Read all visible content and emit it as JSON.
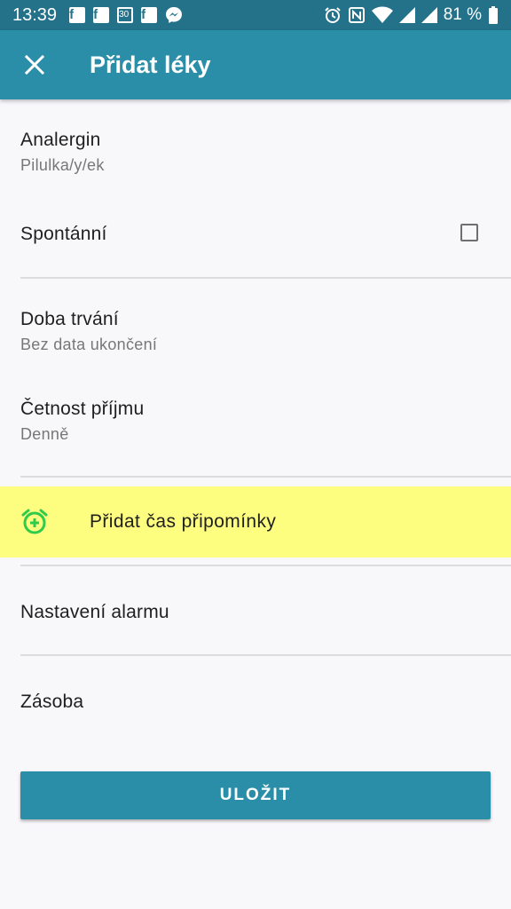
{
  "status_bar": {
    "time": "13:39",
    "notification_icons": [
      "facebook-icon",
      "facebook-icon",
      "calendar-icon",
      "facebook-icon",
      "messenger-icon"
    ],
    "calendar_date": "30",
    "system_icons": [
      "alarm-clock-icon",
      "nfc-icon",
      "wifi-icon",
      "signal-icon",
      "signal-icon"
    ],
    "battery_text": "81 %"
  },
  "app_bar": {
    "title": "Přidat léky",
    "close_icon": "close-icon"
  },
  "items": {
    "medication": {
      "title": "Analergin",
      "subtitle": "Pilulka/y/ek"
    },
    "spontaneous": {
      "title": "Spontánní",
      "checked": false
    },
    "duration": {
      "title": "Doba trvání",
      "subtitle": "Bez data ukončení"
    },
    "frequency": {
      "title": "Četnost příjmu",
      "subtitle": "Denně"
    },
    "add_reminder": {
      "label": "Přidat čas připomínky",
      "icon": "alarm-add-icon"
    },
    "alarm_settings": {
      "title": "Nastavení alarmu"
    },
    "stock": {
      "title": "Zásoba"
    }
  },
  "save_button": {
    "label": "ULOŽIT"
  },
  "colors": {
    "primary": "#2a8ea9",
    "status_bar": "#23728a",
    "highlight": "#fdfd80",
    "alarm_icon": "#2ecc4a"
  }
}
